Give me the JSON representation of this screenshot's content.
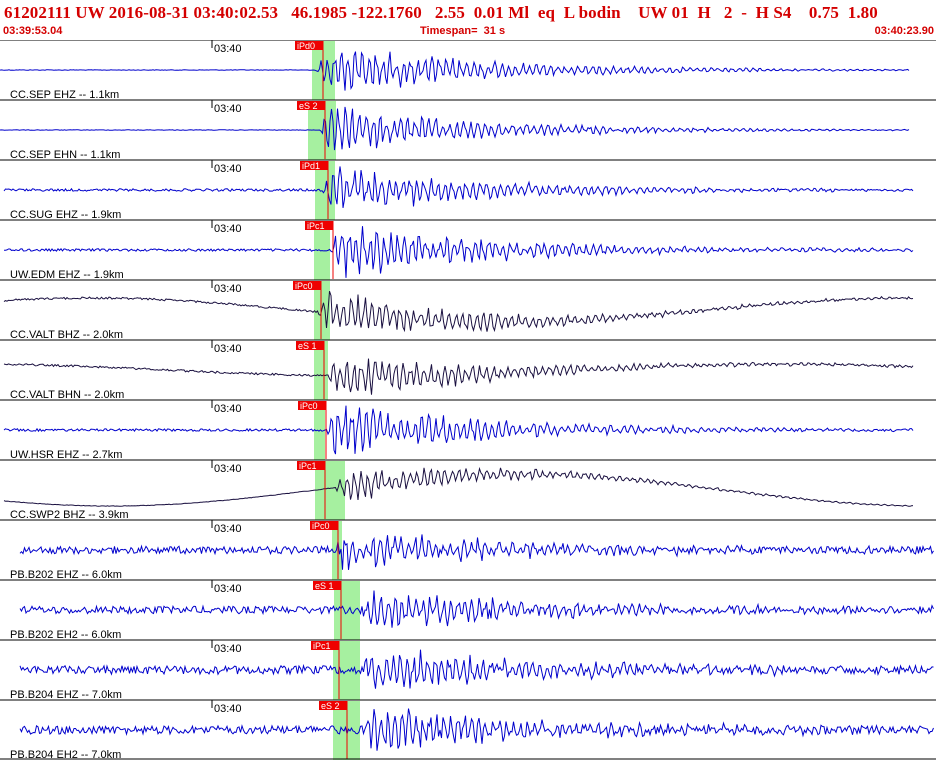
{
  "header": {
    "title": "61202111 UW 2016-08-31 03:40:02.53   46.1985 -122.1760   2.55  0.01 Ml  eq  L bodin    UW 01  H   2  -  H S4    0.75  1.80",
    "start_time": "03:39:53.04",
    "timespan": "Timespan=  31 s",
    "end_time": "03:40:23.90"
  },
  "colors": {
    "header_text": "#d40000",
    "trace_blue": "#0000cc",
    "trace_dark": "#1a1040",
    "pick_red": "#ee0000",
    "window_green": "#a6f0a0",
    "separator": "#000000"
  },
  "traces": [
    {
      "label": "CC.SEP EHZ -- 1.1km",
      "time_label": "03:40",
      "pick": "iPd0",
      "pick_time": 1.5,
      "window": [
        1.2,
        3.5
      ],
      "onset": 1.5,
      "amp": 0.55,
      "noise": 0.01,
      "long_period": 0,
      "color": "blue",
      "extra_pick": "",
      "extra_time": null
    },
    {
      "label": "CC.SEP EHN -- 1.1km",
      "time_label": "03:40",
      "pick": "eS 2",
      "pick_time": 1.7,
      "window": [
        0.8,
        3.6
      ],
      "onset": 1.9,
      "amp": 0.5,
      "noise": 0.01,
      "long_period": 0,
      "color": "blue",
      "extra_pick": "",
      "extra_time": null
    },
    {
      "label": "CC.SUG EHZ -- 1.9km",
      "time_label": "03:40",
      "pick": "iPd1",
      "pick_time": 2.0,
      "window": [
        1.5,
        3.5
      ],
      "onset": 2.1,
      "amp": 0.5,
      "noise": 0.05,
      "long_period": 0,
      "color": "blue",
      "extra_pick": "",
      "extra_time": null
    },
    {
      "label": "UW.EDM EHZ -- 1.9km",
      "time_label": "03:40",
      "pick": "iPc1",
      "pick_time": 2.5,
      "window": [
        1.4,
        3.0
      ],
      "onset": 3.0,
      "amp": 0.6,
      "noise": 0.05,
      "long_period": 0,
      "color": "blue",
      "extra_pick": "",
      "extra_time": null
    },
    {
      "label": "CC.VALT BHZ -- 2.0km",
      "time_label": "03:40",
      "pick": "iPc0",
      "pick_time": 1.3,
      "window": [
        1.4,
        3.0
      ],
      "onset": 1.8,
      "amp": 0.5,
      "noise": 0.04,
      "long_period": 0.3,
      "color": "dark",
      "extra_pick": "",
      "extra_time": null
    },
    {
      "label": "CC.VALT BHN -- 2.0km",
      "time_label": "03:40",
      "pick": "eS 1",
      "pick_time": 1.6,
      "window": [
        1.4,
        2.8
      ],
      "onset": 2.8,
      "amp": 0.45,
      "noise": 0.04,
      "long_period": 0.15,
      "color": "dark",
      "extra_pick": "",
      "extra_time": null
    },
    {
      "label": "UW.HSR EHZ -- 2.7km",
      "time_label": "03:40",
      "pick": "iPc0",
      "pick_time": 1.8,
      "window": [
        1.4,
        2.5
      ],
      "onset": 2.6,
      "amp": 0.6,
      "noise": 0.05,
      "long_period": 0,
      "color": "blue",
      "extra_pick": "",
      "extra_time": null
    },
    {
      "label": "CC.SWP2 BHZ -- 3.9km",
      "time_label": "03:40",
      "pick": "iPc1",
      "pick_time": 1.7,
      "window": [
        1.5,
        4.5
      ],
      "onset": 3.5,
      "amp": 0.35,
      "noise": 0.01,
      "long_period": 0.4,
      "color": "dark",
      "extra_pick": "",
      "extra_time": null
    },
    {
      "label": "PB.B202 EHZ -- 6.0km",
      "time_label": "03:40",
      "pick": "iPc0",
      "pick_time": 3.0,
      "window": [
        3.2,
        4.2
      ],
      "onset": 3.3,
      "amp": 0.45,
      "noise": 0.15,
      "long_period": 0,
      "color": "blue",
      "extra_pick": "",
      "extra_time": null
    },
    {
      "label": "PB.B202 EH2 -- 6.0km",
      "time_label": "03:40",
      "pick": "eS 1",
      "pick_time": 3.3,
      "window": [
        3.4,
        6.0
      ],
      "onset": 6.2,
      "amp": 0.45,
      "noise": 0.15,
      "long_period": 0,
      "color": "blue",
      "extra_pick": "",
      "extra_time": null
    },
    {
      "label": "PB.B204 EHZ -- 7.0km",
      "time_label": "03:40",
      "pick": "iPc1",
      "pick_time": 3.1,
      "window": [
        3.3,
        6.0
      ],
      "onset": 6.0,
      "amp": 0.5,
      "noise": 0.17,
      "long_period": 0,
      "color": "blue",
      "extra_pick": "",
      "extra_time": null
    },
    {
      "label": "PB.B204 EH2 -- 7.0km",
      "time_label": "03:40",
      "pick": "eS 2",
      "pick_time": 3.9,
      "window": [
        3.3,
        6.0
      ],
      "onset": 6.2,
      "amp": 0.5,
      "noise": 0.17,
      "long_period": 0,
      "color": "blue",
      "extra_pick": "",
      "extra_time": null
    }
  ]
}
